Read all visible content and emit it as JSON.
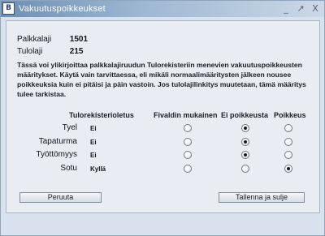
{
  "window": {
    "title": "Vakuutuspoikkeukset",
    "app_icon_glyph": "B",
    "controls": {
      "minimize": "_",
      "maximize": "↗",
      "close": "X"
    }
  },
  "info": {
    "palkkalaji_label": "Palkkalaji",
    "palkkalaji_value": "1501",
    "tulolaji_label": "Tulolaji",
    "tulolaji_value": "215"
  },
  "description": "Tässä voi ylikirjoittaa palkkalajiruudun Tulorekisteriin menevien vakuutuspoikkeusten määritykset. Käytä vain tarvittaessa, eli mikäli normaalimääritysten jälkeen nousee poikkeuksia kuin ei pitäisi ja päin vastoin. Jos tulolajilinkitys muutetaan, tämä määritys tulee tarkistaa.",
  "table": {
    "headers": {
      "default": "Tulorekisterioletus",
      "fivaldi": "Fivaldin mukainen",
      "no_exception": "Ei poikkeusta",
      "exception": "Poikkeus"
    },
    "rows": [
      {
        "label": "Tyel",
        "default": "Ei",
        "selected": "no_exception"
      },
      {
        "label": "Tapaturma",
        "default": "Ei",
        "selected": "no_exception"
      },
      {
        "label": "Työttömyys",
        "default": "Ei",
        "selected": "no_exception"
      },
      {
        "label": "Sotu",
        "default": "Kyllä",
        "selected": "exception"
      }
    ]
  },
  "buttons": {
    "cancel": "Peruuta",
    "save_close": "Tallenna ja sulje"
  },
  "colors": {
    "titlebar_start": "#6d8fb5",
    "panel_bg": "#e7edf3",
    "window_bg": "#d9e2ec"
  }
}
